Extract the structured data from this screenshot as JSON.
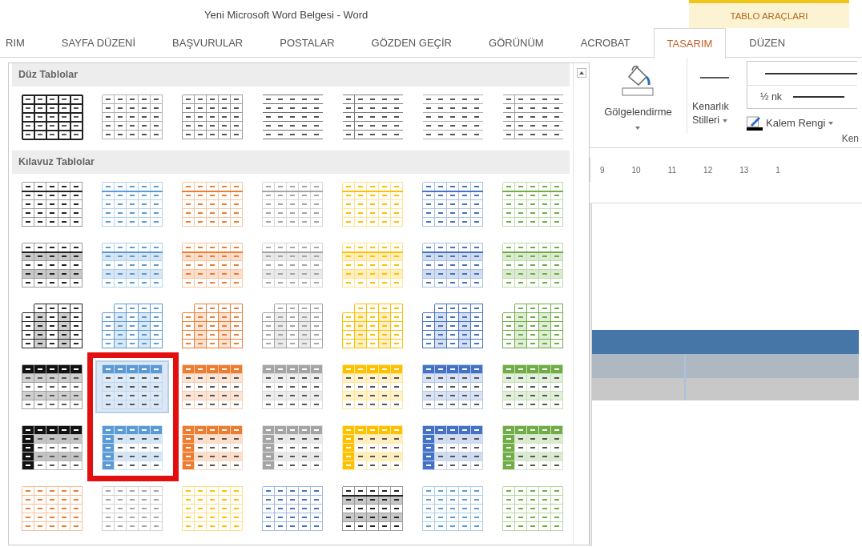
{
  "window": {
    "title": "Yeni Microsoft Word Belgesi - Word",
    "context_group": "TABLO ARAÇLARI"
  },
  "tabs": [
    {
      "label": "RIM",
      "selected": false
    },
    {
      "label": "SAYFA DÜZENİ",
      "selected": false
    },
    {
      "label": "BAŞVURULAR",
      "selected": false
    },
    {
      "label": "POSTALAR",
      "selected": false
    },
    {
      "label": "GÖZDEN GEÇİR",
      "selected": false
    },
    {
      "label": "GÖRÜNÜM",
      "selected": false
    },
    {
      "label": "ACROBAT",
      "selected": false
    },
    {
      "label": "TASARIM",
      "selected": true
    },
    {
      "label": "DÜZEN",
      "selected": false
    }
  ],
  "ribbon": {
    "shading": {
      "label": "Gölgelendirme"
    },
    "border_styles": {
      "label": "Kenarlık Stilleri"
    },
    "line_weight": {
      "value": "½ nk"
    },
    "pen_color": {
      "label": "Kalem Rengi"
    },
    "group_label": "Ken"
  },
  "ruler": {
    "marks": [
      "9",
      "10",
      "11",
      "12",
      "13",
      "1"
    ]
  },
  "gallery": {
    "sections": [
      {
        "title": "Düz Tablolar",
        "rows": [
          [
            {
              "kind": "grid",
              "color": "#222222",
              "selected": false
            },
            {
              "kind": "grid",
              "color": "#b0b0b0",
              "selected": false
            },
            {
              "kind": "grid",
              "color": "#9a9a9a",
              "selected": false
            },
            {
              "kind": "lines",
              "color": "#707070",
              "selected": false
            },
            {
              "kind": "lines-firstcol",
              "color": "#808080",
              "selected": false
            },
            {
              "kind": "lines",
              "color": "#b0b0b0",
              "selected": false
            },
            {
              "kind": "lines-firstcol",
              "color": "#a0a0a0",
              "selected": false
            }
          ]
        ]
      },
      {
        "title": "Kılavuz Tablolar",
        "rows": [
          [
            {
              "kind": "grid-header-line",
              "color": "#222222",
              "selected": false
            },
            {
              "kind": "grid-header-line",
              "color": "#5b9bd5",
              "selected": false
            },
            {
              "kind": "grid-header-line",
              "color": "#ed7d31",
              "selected": false
            },
            {
              "kind": "grid-header-line",
              "color": "#a5a5a5",
              "selected": false
            },
            {
              "kind": "grid-header-line",
              "color": "#ffc000",
              "selected": false
            },
            {
              "kind": "grid-header-line",
              "color": "#4472c4",
              "selected": false
            },
            {
              "kind": "grid-header-line",
              "color": "#70ad47",
              "selected": false
            }
          ],
          [
            {
              "kind": "grid-banded",
              "color": "#222222",
              "selected": false
            },
            {
              "kind": "grid-banded",
              "color": "#5b9bd5",
              "selected": false
            },
            {
              "kind": "grid-banded",
              "color": "#ed7d31",
              "selected": false
            },
            {
              "kind": "grid-banded",
              "color": "#a5a5a5",
              "selected": false
            },
            {
              "kind": "grid-banded",
              "color": "#ffc000",
              "selected": false
            },
            {
              "kind": "grid-banded",
              "color": "#4472c4",
              "selected": false
            },
            {
              "kind": "grid-banded",
              "color": "#70ad47",
              "selected": false
            }
          ],
          [
            {
              "kind": "grid-firstcol",
              "color": "#222222",
              "selected": false
            },
            {
              "kind": "grid-firstcol",
              "color": "#5b9bd5",
              "selected": false
            },
            {
              "kind": "grid-firstcol",
              "color": "#ed7d31",
              "selected": false
            },
            {
              "kind": "grid-firstcol",
              "color": "#a5a5a5",
              "selected": false
            },
            {
              "kind": "grid-firstcol",
              "color": "#ffc000",
              "selected": false
            },
            {
              "kind": "grid-firstcol",
              "color": "#4472c4",
              "selected": false
            },
            {
              "kind": "grid-firstcol",
              "color": "#70ad47",
              "selected": false
            }
          ],
          [
            {
              "kind": "grid-header",
              "color": "#111111",
              "selected": false
            },
            {
              "kind": "grid-header",
              "color": "#5b9bd5",
              "selected": true
            },
            {
              "kind": "grid-header",
              "color": "#ed7d31",
              "selected": false
            },
            {
              "kind": "grid-header",
              "color": "#a5a5a5",
              "selected": false
            },
            {
              "kind": "grid-header",
              "color": "#ffc000",
              "selected": false
            },
            {
              "kind": "grid-header",
              "color": "#4472c4",
              "selected": false
            },
            {
              "kind": "grid-header",
              "color": "#70ad47",
              "selected": false
            }
          ],
          [
            {
              "kind": "grid-header-firstcol",
              "color": "#111111",
              "selected": false
            },
            {
              "kind": "grid-header-firstcol",
              "color": "#5b9bd5",
              "selected": false
            },
            {
              "kind": "grid-header-firstcol",
              "color": "#ed7d31",
              "selected": false
            },
            {
              "kind": "grid-header-firstcol",
              "color": "#a5a5a5",
              "selected": false
            },
            {
              "kind": "grid-header-firstcol",
              "color": "#ffc000",
              "selected": false
            },
            {
              "kind": "grid-header-firstcol",
              "color": "#4472c4",
              "selected": false
            },
            {
              "kind": "grid-header-firstcol",
              "color": "#70ad47",
              "selected": false
            }
          ],
          [
            {
              "kind": "grid-tint",
              "color": "#ed7d31",
              "selected": false
            },
            {
              "kind": "grid-tint",
              "color": "#a5a5a5",
              "selected": false
            },
            {
              "kind": "grid-tint",
              "color": "#ffc000",
              "selected": false
            },
            {
              "kind": "grid-tint",
              "color": "#4472c4",
              "selected": false
            },
            {
              "kind": "grid-banded",
              "color": "#222222",
              "selected": false
            },
            {
              "kind": "grid-tint",
              "color": "#5b9bd5",
              "selected": false
            },
            {
              "kind": "grid-tint",
              "color": "#70ad47",
              "selected": false
            }
          ]
        ]
      }
    ]
  }
}
